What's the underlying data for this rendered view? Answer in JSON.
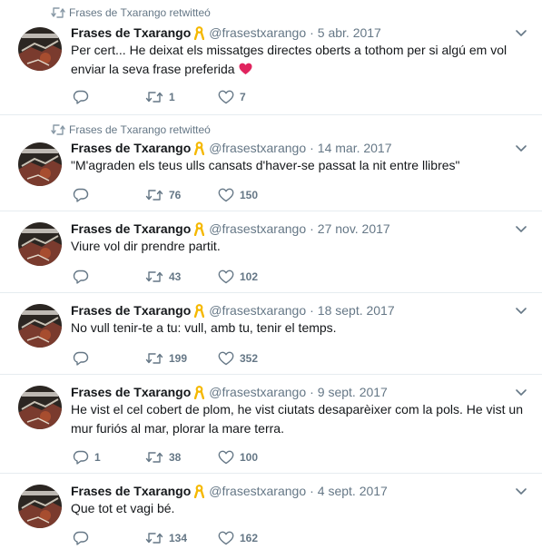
{
  "account": {
    "name": "Frases de Txarango",
    "handle": "@frasestxarango"
  },
  "retweet_label": "Frases de Txarango retwitteó",
  "colors": {
    "text": "#14171a",
    "secondary": "#657786",
    "border": "#e6ecf0",
    "ribbon": "#f5b800",
    "heart_emoji": "#e0245e"
  },
  "icons": {
    "reply": "reply-icon",
    "retweet": "retweet-icon",
    "like": "like-icon",
    "menu": "chevron-down-icon",
    "ribbon": "yellow-ribbon-icon"
  },
  "tweets": [
    {
      "retweeted": true,
      "dot": "·",
      "date": "5 abr. 2017",
      "text": "Per cert... He deixat els missatges directes oberts a tothom per si algú em vol enviar la seva frase preferida",
      "emoji": "red-heart",
      "replies": "",
      "retweets": "1",
      "likes": "7"
    },
    {
      "retweeted": true,
      "dot": "·",
      "date": "14 mar. 2017",
      "text": "\"M'agraden els teus ulls cansats d'haver-se passat la nit entre llibres\"",
      "replies": "",
      "retweets": "76",
      "likes": "150"
    },
    {
      "retweeted": false,
      "dot": "·",
      "date": "27 nov. 2017",
      "text": "Viure vol dir prendre partit.",
      "replies": "",
      "retweets": "43",
      "likes": "102"
    },
    {
      "retweeted": false,
      "dot": "·",
      "date": "18 sept. 2017",
      "text": "No vull tenir-te a tu: vull, amb tu, tenir el temps.",
      "replies": "",
      "retweets": "199",
      "likes": "352"
    },
    {
      "retweeted": false,
      "dot": "·",
      "date": "9 sept. 2017",
      "text": "He vist el cel cobert de plom, he vist ciutats desaparèixer com la pols. He vist un mur furiós al mar, plorar la mare terra.",
      "replies": "1",
      "retweets": "38",
      "likes": "100"
    },
    {
      "retweeted": false,
      "dot": "·",
      "date": "4 sept. 2017",
      "text": "Que tot et vagi bé.",
      "replies": "",
      "retweets": "134",
      "likes": "162"
    }
  ]
}
